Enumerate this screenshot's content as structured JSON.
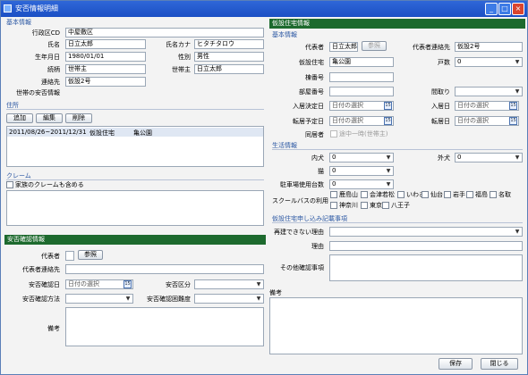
{
  "window": {
    "title": "安否情報明細"
  },
  "left": {
    "basic": {
      "section": "基本情報",
      "district_label": "行政区CD",
      "district_value": "中屋敷区",
      "name_label": "氏名",
      "name_value": "日立太郎",
      "kana_label": "氏名カナ",
      "kana_value": "ヒタチタロウ",
      "birth_label": "生年月日",
      "birth_value": "1980/01/01",
      "gender_label": "性別",
      "gender_value": "男性",
      "relation_label": "続柄",
      "relation_value": "世帯主",
      "head_label": "世帯主",
      "head_value": "日立太郎",
      "contact_label": "連絡先",
      "contact_value": "仮設2号",
      "household_label": "世帯の安否情報"
    },
    "address": {
      "section": "住所",
      "add": "追加",
      "edit": "編集",
      "delete": "削除",
      "row": {
        "period": "2011/08/26~2011/12/31",
        "type": "仮設住宅",
        "place": "亀公園"
      }
    },
    "claim": {
      "section": "クレーム",
      "checkbox_label": "家族のクレームも含める"
    },
    "safety": {
      "header": "安否確認情報",
      "rep_label": "代表者",
      "ref_button": "参照",
      "rep_contact_label": "代表者連絡先",
      "date_label": "安否確認日",
      "date_placeholder": "日付の選択",
      "class_label": "安否区分",
      "method_label": "安否確認方法",
      "difficulty_label": "安否確認困難度",
      "note_label": "備考"
    }
  },
  "right": {
    "header": "仮設住宅情報",
    "basic": {
      "section": "基本情報",
      "rep_label": "代表者",
      "rep_value": "日立太郎",
      "ref_button": "参照",
      "rep_contact_label": "代表者連絡先",
      "rep_contact_value": "仮設2号",
      "housing_label": "仮設住宅",
      "housing_value": "亀公園",
      "units_label": "戸数",
      "units_value": "0",
      "building_label": "棟番号",
      "room_label": "部屋番号",
      "layout_label": "間取り",
      "move_decide_label": "入居決定日",
      "move_decide_value": "日付の選択",
      "move_in_label": "入居日",
      "move_in_value": "日付の選択",
      "move_out_plan_label": "転居予定日",
      "move_out_plan_value": "日付の選択",
      "move_out_label": "転居日",
      "move_out_value": "日付の選択",
      "cohab_label": "同居者",
      "cohab_check": "途中一時(世帯主)"
    },
    "life": {
      "section": "生活情報",
      "inner_label": "内犬",
      "inner_value": "0",
      "outer_label": "外犬",
      "outer_value": "0",
      "cat_label": "猫",
      "cat_value": "0",
      "parking_label": "駐車場使用台数",
      "parking_value": "0",
      "bus_label": "スクールバスの利用",
      "bus_options": [
        "鹿島山",
        "会津若松",
        "いわき",
        "仙台",
        "岩手",
        "福島",
        "名取",
        "神奈川",
        "東京",
        "八王子"
      ]
    },
    "apply": {
      "section": "仮設住宅申し込み記載事項",
      "reason_label": "再建できない理由",
      "reason2_label": "理由",
      "other_label": "その他確認事項"
    },
    "note_label": "備考"
  },
  "footer": {
    "save": "保存",
    "close": "閉じる"
  }
}
